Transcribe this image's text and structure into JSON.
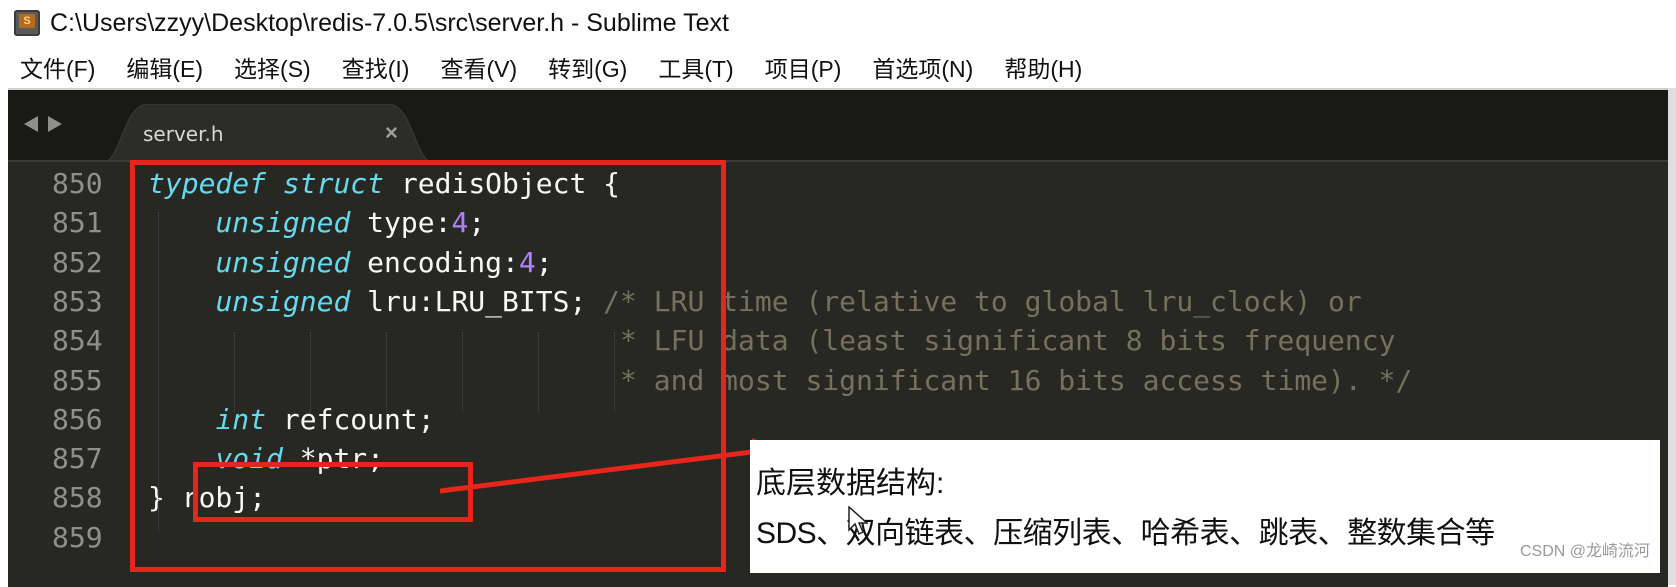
{
  "window": {
    "title": "C:\\Users\\zzyy\\Desktop\\redis-7.0.5\\src\\server.h - Sublime Text",
    "app_icon": "sublime-text-icon"
  },
  "menu": {
    "items": [
      "文件(F)",
      "编辑(E)",
      "选择(S)",
      "查找(I)",
      "查看(V)",
      "转到(G)",
      "工具(T)",
      "项目(P)",
      "首选项(N)",
      "帮助(H)"
    ]
  },
  "tabs": {
    "nav_prev_icon": "triangle-left-icon",
    "nav_next_icon": "triangle-right-icon",
    "items": [
      {
        "label": "server.h",
        "close_glyph": "×",
        "active": true
      }
    ]
  },
  "editor": {
    "theme_colors": {
      "background": "#272822",
      "keyword": "#66d9ef",
      "number": "#ae81ff",
      "comment": "#75715e",
      "text": "#f8f8f2",
      "line_number": "#8f908a",
      "annotation_red": "#e8251b"
    },
    "lines": [
      {
        "number": "850",
        "segments": [
          [
            "kw",
            "typedef"
          ],
          [
            "t",
            " "
          ],
          [
            "kw",
            "struct"
          ],
          [
            "t",
            " redisObject {"
          ]
        ]
      },
      {
        "number": "851",
        "segments": [
          [
            "t",
            "    "
          ],
          [
            "kw",
            "unsigned"
          ],
          [
            "t",
            " type:"
          ],
          [
            "num",
            "4"
          ],
          [
            "t",
            ";"
          ]
        ]
      },
      {
        "number": "852",
        "segments": [
          [
            "t",
            "    "
          ],
          [
            "kw",
            "unsigned"
          ],
          [
            "t",
            " encoding:"
          ],
          [
            "num",
            "4"
          ],
          [
            "t",
            ";"
          ]
        ]
      },
      {
        "number": "853",
        "segments": [
          [
            "t",
            "    "
          ],
          [
            "kw",
            "unsigned"
          ],
          [
            "t",
            " lru:LRU_BITS; "
          ],
          [
            "cmt",
            "/* LRU time (relative to global lru_clock) or"
          ]
        ]
      },
      {
        "number": "854",
        "segments": [
          [
            "t",
            "                            "
          ],
          [
            "cmt",
            "* LFU data (least significant 8 bits frequency"
          ]
        ]
      },
      {
        "number": "855",
        "segments": [
          [
            "t",
            "                            "
          ],
          [
            "cmt",
            "* and most significant 16 bits access time). */"
          ]
        ]
      },
      {
        "number": "856",
        "segments": [
          [
            "t",
            "    "
          ],
          [
            "kw",
            "int"
          ],
          [
            "t",
            " refcount;"
          ]
        ]
      },
      {
        "number": "857",
        "segments": [
          [
            "t",
            "    "
          ],
          [
            "kw",
            "void"
          ],
          [
            "t",
            " *ptr;"
          ]
        ]
      },
      {
        "number": "858",
        "segments": [
          [
            "t",
            "} robj;"
          ]
        ]
      },
      {
        "number": "859",
        "segments": []
      }
    ]
  },
  "annotation": {
    "title": "底层数据结构:",
    "body": "SDS、双向链表、压缩列表、哈希表、跳表、整数集合等",
    "watermark": "CSDN @龙崎流河"
  }
}
